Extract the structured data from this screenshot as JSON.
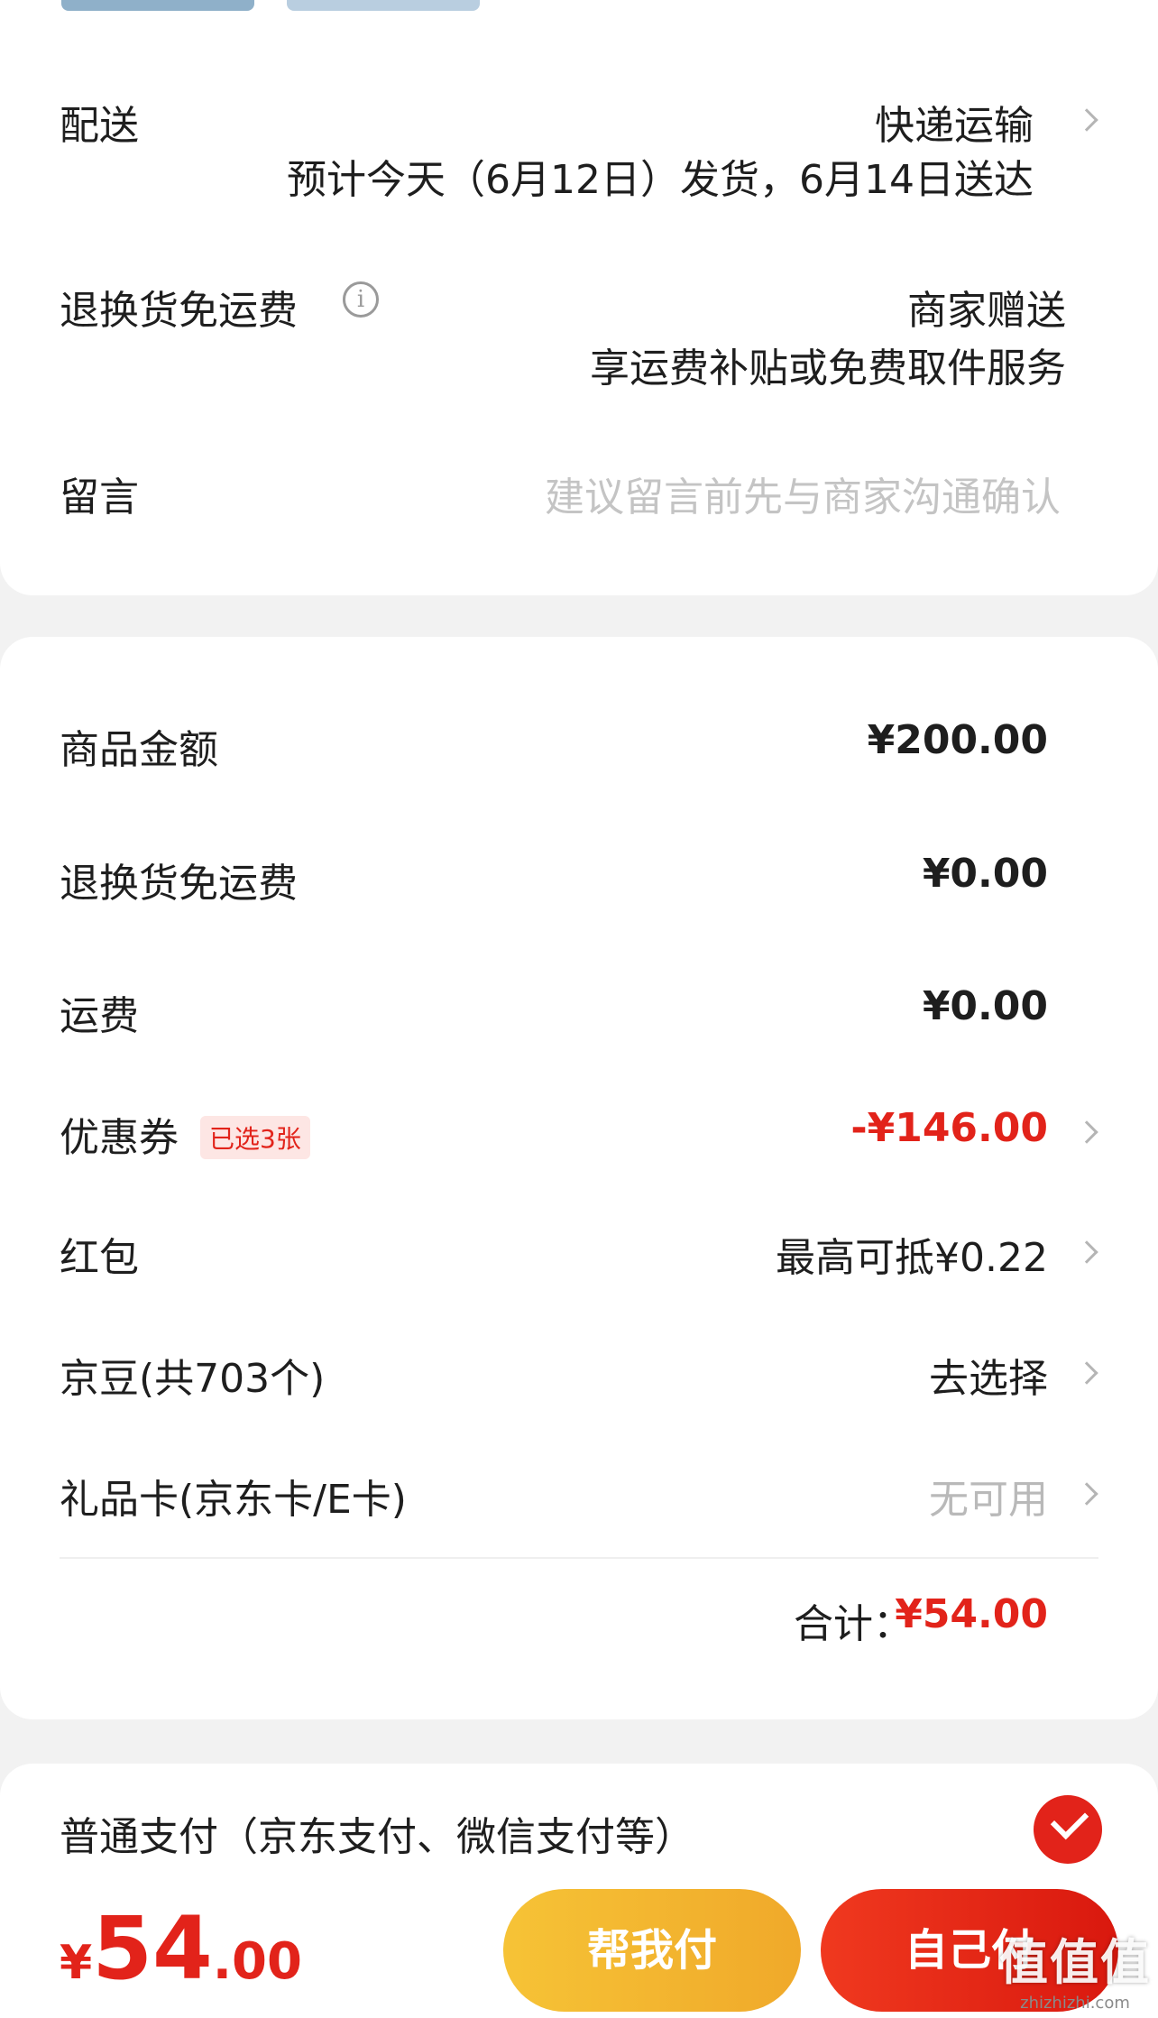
{
  "delivery": {
    "label": "配送",
    "method": "快递运输",
    "estimate": "预计今天（6月12日）发货，6月14日送达"
  },
  "return_shipping": {
    "label": "退换货免运费",
    "value": "商家赠送",
    "subvalue": "享运费补贴或免费取件服务",
    "icon": "info-icon"
  },
  "message": {
    "label": "留言",
    "placeholder": "建议留言前先与商家沟通确认"
  },
  "summary": {
    "goods_amount": {
      "label": "商品金额",
      "value": "¥200.00"
    },
    "return_fee": {
      "label": "退换货免运费",
      "value": "¥0.00"
    },
    "shipping": {
      "label": "运费",
      "value": "¥0.00"
    },
    "coupon": {
      "label": "优惠券",
      "tag": "已选3张",
      "value": "-¥146.00"
    },
    "red_packet": {
      "label": "红包",
      "value": "最高可抵¥0.22"
    },
    "jd_beans": {
      "label": "京豆(共703个)",
      "value": "去选择"
    },
    "gift_card": {
      "label": "礼品卡(京东卡/E卡)",
      "value": "无可用"
    },
    "total_label": "合计：",
    "total_value": "¥54.00"
  },
  "payment": {
    "method_label": "普通支付（京东支付、微信支付等）",
    "selected": true
  },
  "footer": {
    "price_currency": "¥",
    "price_int": "54",
    "price_dec": ".00",
    "help_pay_label": "帮我付",
    "self_pay_label": "自己付"
  },
  "watermark": {
    "main": "值值值",
    "sub": "zhizhizhi.com"
  },
  "colors": {
    "accent_red": "#e2231a",
    "help_button": "#f0a92a",
    "background": "#f2f2f2"
  }
}
